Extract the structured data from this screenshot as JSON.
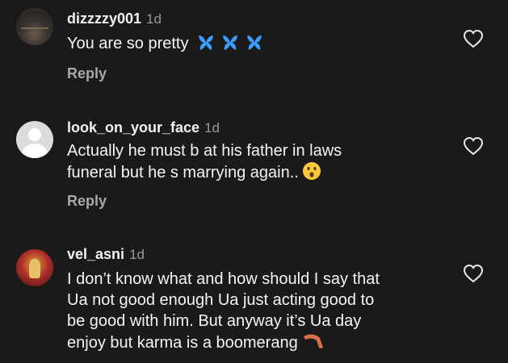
{
  "comments": [
    {
      "username": "dizzzzy001",
      "age": "1d",
      "lines": [
        "You are so pretty"
      ],
      "emoji": "butterfly-emoji-x3",
      "reply_label": "Reply"
    },
    {
      "username": "look_on_your_face",
      "age": "1d",
      "lines": [
        "Actually he must b at his father in laws",
        "funeral but he s marrying again.."
      ],
      "emoji": "astonished-face-emoji",
      "reply_label": "Reply"
    },
    {
      "username": "vel_asni",
      "age": "1d",
      "lines": [
        "I don’t know what and how should I say that",
        "Ua not good enough Ua just acting good to",
        "be good with him. But anyway it’s Ua day",
        "enjoy but karma is a boomerang"
      ],
      "emoji": "boomerang-emoji"
    }
  ],
  "colors": {
    "background": "#1a1a1a",
    "text": "#f5f5f5",
    "muted": "#9a9a9a",
    "butterfly": "#3aa0ff",
    "boomerang": "#d4704a",
    "emoji_face": "#ffc83a"
  }
}
